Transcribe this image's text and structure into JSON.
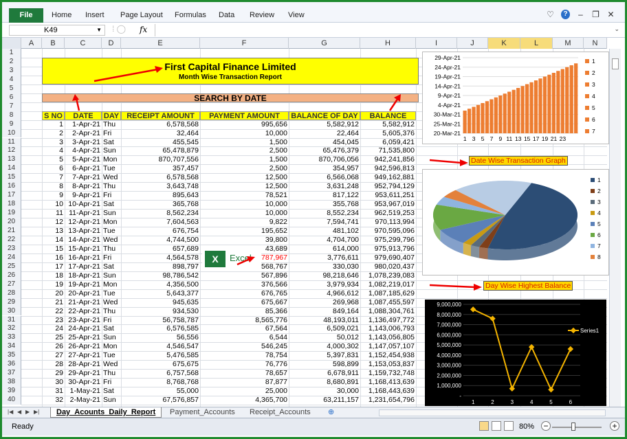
{
  "ribbon": {
    "file": "File",
    "tabs": [
      "Home",
      "Insert",
      "Page Layout",
      "Formulas",
      "Data",
      "Review",
      "View"
    ]
  },
  "formula_bar": {
    "name_box": "K49",
    "fx": "fx",
    "value": ""
  },
  "columns": [
    "A",
    "B",
    "C",
    "D",
    "E",
    "F",
    "G",
    "H",
    "I",
    "J",
    "K",
    "L",
    "M",
    "N"
  ],
  "selected_columns": [
    "K",
    "L"
  ],
  "rows": [
    "1",
    "2",
    "3",
    "4",
    "5",
    "6",
    "7",
    "8",
    "9",
    "10",
    "11",
    "12",
    "13",
    "14",
    "15",
    "16",
    "17",
    "18",
    "19",
    "20",
    "21",
    "22",
    "23",
    "24",
    "25",
    "26",
    "27",
    "28",
    "29",
    "30",
    "31",
    "32",
    "33",
    "34",
    "35",
    "36",
    "37",
    "38",
    "39",
    "40"
  ],
  "report": {
    "title": "First Capital Finance Limited",
    "subtitle": "Month Wise Transaction Report",
    "search_label": "SEARCH BY DATE"
  },
  "table": {
    "headers": [
      "S NO",
      "DATE",
      "DAY",
      "RECEIPT AMOUNT",
      "PAYMENT AMOUNT",
      "BALANCE OF DAY",
      "BALANCE"
    ],
    "rows": [
      [
        "1",
        "1-Apr-21",
        "Thu",
        "6,578,568",
        "995,656",
        "5,582,912",
        "5,582,912"
      ],
      [
        "2",
        "2-Apr-21",
        "Fri",
        "32,464",
        "10,000",
        "22,464",
        "5,605,376"
      ],
      [
        "3",
        "3-Apr-21",
        "Sat",
        "455,545",
        "1,500",
        "454,045",
        "6,059,421"
      ],
      [
        "4",
        "4-Apr-21",
        "Sun",
        "65,478,879",
        "2,500",
        "65,476,379",
        "71,535,800"
      ],
      [
        "5",
        "5-Apr-21",
        "Mon",
        "870,707,556",
        "1,500",
        "870,706,056",
        "942,241,856"
      ],
      [
        "6",
        "6-Apr-21",
        "Tue",
        "357,457",
        "2,500",
        "354,957",
        "942,596,813"
      ],
      [
        "7",
        "7-Apr-21",
        "Wed",
        "6,578,568",
        "12,500",
        "6,566,068",
        "949,162,881"
      ],
      [
        "8",
        "8-Apr-21",
        "Thu",
        "3,643,748",
        "12,500",
        "3,631,248",
        "952,794,129"
      ],
      [
        "9",
        "9-Apr-21",
        "Fri",
        "895,643",
        "78,521",
        "817,122",
        "953,611,251"
      ],
      [
        "10",
        "10-Apr-21",
        "Sat",
        "365,768",
        "10,000",
        "355,768",
        "953,967,019"
      ],
      [
        "11",
        "11-Apr-21",
        "Sun",
        "8,562,234",
        "10,000",
        "8,552,234",
        "962,519,253"
      ],
      [
        "12",
        "12-Apr-21",
        "Mon",
        "7,604,563",
        "9,822",
        "7,594,741",
        "970,113,994"
      ],
      [
        "13",
        "13-Apr-21",
        "Tue",
        "676,754",
        "195,652",
        "481,102",
        "970,595,096"
      ],
      [
        "14",
        "14-Apr-21",
        "Wed",
        "4,744,500",
        "39,800",
        "4,704,700",
        "975,299,796"
      ],
      [
        "15",
        "15-Apr-21",
        "Thu",
        "657,689",
        "43,689",
        "614,000",
        "975,913,796"
      ],
      [
        "16",
        "16-Apr-21",
        "Fri",
        "4,564,578",
        "787,967",
        "3,776,611",
        "979,690,407"
      ],
      [
        "17",
        "17-Apr-21",
        "Sat",
        "898,797",
        "568,767",
        "330,030",
        "980,020,437"
      ],
      [
        "18",
        "18-Apr-21",
        "Sun",
        "98,786,542",
        "567,896",
        "98,218,646",
        "1,078,239,083"
      ],
      [
        "19",
        "19-Apr-21",
        "Mon",
        "4,356,500",
        "376,566",
        "3,979,934",
        "1,082,219,017"
      ],
      [
        "20",
        "20-Apr-21",
        "Tue",
        "5,643,377",
        "676,765",
        "4,966,612",
        "1,087,185,629"
      ],
      [
        "21",
        "21-Apr-21",
        "Wed",
        "945,635",
        "675,667",
        "269,968",
        "1,087,455,597"
      ],
      [
        "22",
        "22-Apr-21",
        "Thu",
        "934,530",
        "85,366",
        "849,164",
        "1,088,304,761"
      ],
      [
        "23",
        "23-Apr-21",
        "Fri",
        "56,758,787",
        "8,565,776",
        "48,193,011",
        "1,136,497,772"
      ],
      [
        "24",
        "24-Apr-21",
        "Sat",
        "6,576,585",
        "67,564",
        "6,509,021",
        "1,143,006,793"
      ],
      [
        "25",
        "25-Apr-21",
        "Sun",
        "56,556",
        "6,544",
        "50,012",
        "1,143,056,805"
      ],
      [
        "26",
        "26-Apr-21",
        "Mon",
        "4,546,547",
        "546,245",
        "4,000,302",
        "1,147,057,107"
      ],
      [
        "27",
        "27-Apr-21",
        "Tue",
        "5,476,585",
        "78,754",
        "5,397,831",
        "1,152,454,938"
      ],
      [
        "28",
        "28-Apr-21",
        "Wed",
        "675,675",
        "76,776",
        "598,899",
        "1,153,053,837"
      ],
      [
        "29",
        "29-Apr-21",
        "Thu",
        "6,757,568",
        "78,657",
        "6,678,911",
        "1,159,732,748"
      ],
      [
        "30",
        "30-Apr-21",
        "Fri",
        "8,768,768",
        "87,877",
        "8,680,891",
        "1,168,413,639"
      ],
      [
        "31",
        "1-May-21",
        "Sat",
        "55,000",
        "25,000",
        "30,000",
        "1,168,443,639"
      ],
      [
        "32",
        "2-May-21",
        "Sun",
        "67,576,857",
        "4,365,700",
        "63,211,157",
        "1,231,654,796"
      ]
    ],
    "highlight": {
      "row": 15,
      "col": 4,
      "color": "#ff0000"
    }
  },
  "excel_logo": {
    "icon": "X",
    "text": "Excel"
  },
  "annotations": {
    "graph_label": "Date Wise Transaction Graph",
    "balance_label": "Day Wise Highest Balance"
  },
  "chart_data": [
    {
      "type": "bar",
      "title": "",
      "y_ticks": [
        "20-Mar-21",
        "25-Mar-21",
        "30-Mar-21",
        "4-Apr-21",
        "9-Apr-21",
        "14-Apr-21",
        "19-Apr-21",
        "24-Apr-21",
        "29-Apr-21"
      ],
      "x_ticks": [
        "1",
        "3",
        "5",
        "7",
        "9",
        "11",
        "13",
        "15",
        "17",
        "19",
        "21",
        "23"
      ],
      "categories": [
        "1",
        "2",
        "3",
        "4",
        "5",
        "6",
        "7",
        "8",
        "9",
        "10",
        "11",
        "12",
        "13",
        "14",
        "15",
        "16",
        "17",
        "18",
        "19",
        "20",
        "21",
        "22",
        "23",
        "24",
        "25",
        "26"
      ],
      "values": [
        44287,
        44288,
        44289,
        44290,
        44291,
        44292,
        44293,
        44294,
        44295,
        44296,
        44297,
        44298,
        44299,
        44300,
        44301,
        44302,
        44303,
        44304,
        44305,
        44306,
        44307,
        44308,
        44309,
        44310,
        44311,
        44312
      ],
      "ylim": [
        44275,
        44315
      ],
      "legend": [
        "1",
        "2",
        "3",
        "4",
        "5",
        "6",
        "7"
      ],
      "color": "#ed7d31"
    },
    {
      "type": "pie",
      "legend": [
        "1",
        "2",
        "3",
        "4",
        "5",
        "6",
        "7",
        "8"
      ],
      "values": [
        48,
        2,
        2,
        2,
        8,
        12,
        4,
        4,
        18
      ],
      "colors": [
        "#2c4d75",
        "#7f3f19",
        "#5a6b7a",
        "#c89a12",
        "#5b80b8",
        "#6aa843",
        "#8fb4e0",
        "#e3813b",
        "#b8cce4"
      ]
    },
    {
      "type": "line",
      "legend": [
        "Series1"
      ],
      "categories": [
        "1",
        "2",
        "3",
        "4",
        "5",
        "6"
      ],
      "values": [
        8500000,
        7600000,
        700000,
        4800000,
        600000,
        4600000
      ],
      "y_ticks": [
        "-",
        "1,000,000",
        "2,000,000",
        "3,000,000",
        "4,000,000",
        "5,000,000",
        "6,000,000",
        "7,000,000",
        "8,000,000",
        "9,000,000"
      ],
      "ylim": [
        0,
        9000000
      ],
      "color": "#f4b400"
    }
  ],
  "sheets": {
    "tabs": [
      "Day_Acounts_Daily_Report",
      "Payment_Accounts",
      "Receipt_Accounts"
    ],
    "active": 0
  },
  "status": {
    "ready": "Ready",
    "zoom": "80%"
  }
}
